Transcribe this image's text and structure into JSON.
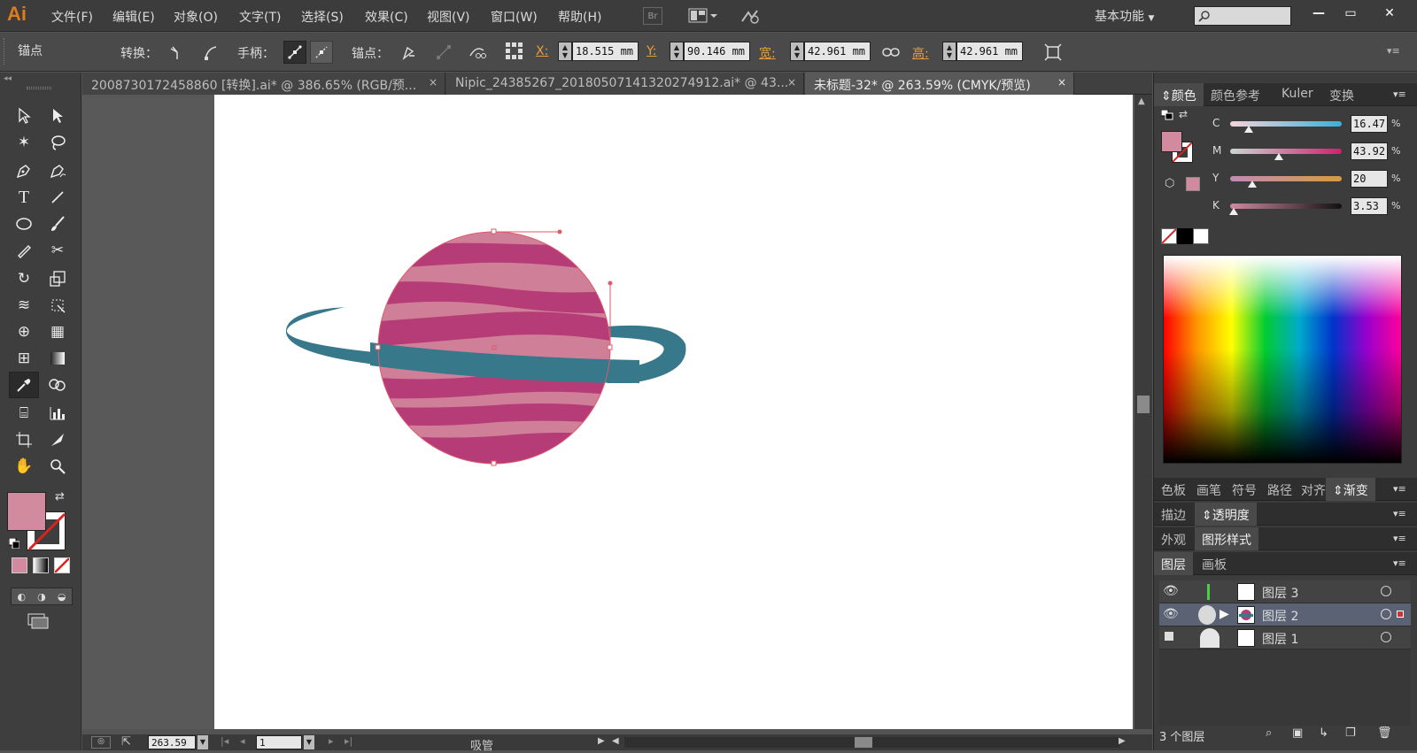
{
  "app": {
    "logo": "Ai",
    "menus": [
      "文件(F)",
      "编辑(E)",
      "对象(O)",
      "文字(T)",
      "选择(S)",
      "效果(C)",
      "视图(V)",
      "窗口(W)",
      "帮助(H)"
    ],
    "bridge_label": "Br",
    "workspace": "基本功能",
    "window_controls": [
      "—",
      "▭",
      "✕"
    ]
  },
  "control_bar": {
    "mode": "锚点",
    "convert_label": "转换：",
    "handle_label": "手柄：",
    "anchor_label": "锚点：",
    "x_label": "X:",
    "x_value": "18.515 mm",
    "y_label": "Y:",
    "y_value": "90.146 mm",
    "w_label": "宽:",
    "w_value": "42.961 mm",
    "h_label": "高:",
    "h_value": "42.961 mm"
  },
  "tabs": [
    {
      "label": "20087301724588​60 [转换].ai* @ 386.65% (RGB/预...",
      "active": false
    },
    {
      "label": "Nipic_24385267_20180507141320274912.ai* @ 43...",
      "active": false
    },
    {
      "label": "未标题-32* @ 263.59% (CMYK/预览)",
      "active": true
    }
  ],
  "status": {
    "zoom": "263.59",
    "page": "1",
    "tool_name": "吸管"
  },
  "color_panel": {
    "tabs": [
      "颜色",
      "颜色参考",
      "Kuler",
      "变换"
    ],
    "channels": [
      {
        "label": "C",
        "value": "16.47",
        "fraction": 0.165
      },
      {
        "label": "M",
        "value": "43.92",
        "fraction": 0.439
      },
      {
        "label": "Y",
        "value": "20",
        "fraction": 0.2
      },
      {
        "label": "K",
        "value": "3.53",
        "fraction": 0.035
      }
    ],
    "percent": "%",
    "fill_color": "#d18a9e"
  },
  "panel_groups": [
    {
      "tabs": [
        "色板",
        "画笔",
        "符号",
        "路径",
        "对齐",
        "渐变"
      ],
      "active": "渐变"
    },
    {
      "tabs": [
        "描边",
        "透明度"
      ],
      "active": "透明度"
    },
    {
      "tabs": [
        "外观",
        "图形样式"
      ],
      "active": "图形样式"
    },
    {
      "tabs": [
        "图层",
        "画板"
      ],
      "active": "图层"
    }
  ],
  "layers": {
    "rows": [
      {
        "name": "图层 3",
        "color": "#4ccc4c",
        "selected": false
      },
      {
        "name": "图层 2",
        "color": "#cc3333",
        "selected": true
      },
      {
        "name": "图层 1",
        "color": "#3366cc",
        "selected": false
      }
    ],
    "count": "3 个图层"
  },
  "artwork": {
    "planet_base": "#cf8098",
    "planet_stripe": "#b63c78",
    "ring_color": "#37788a",
    "path_color": "#e05a6a"
  }
}
